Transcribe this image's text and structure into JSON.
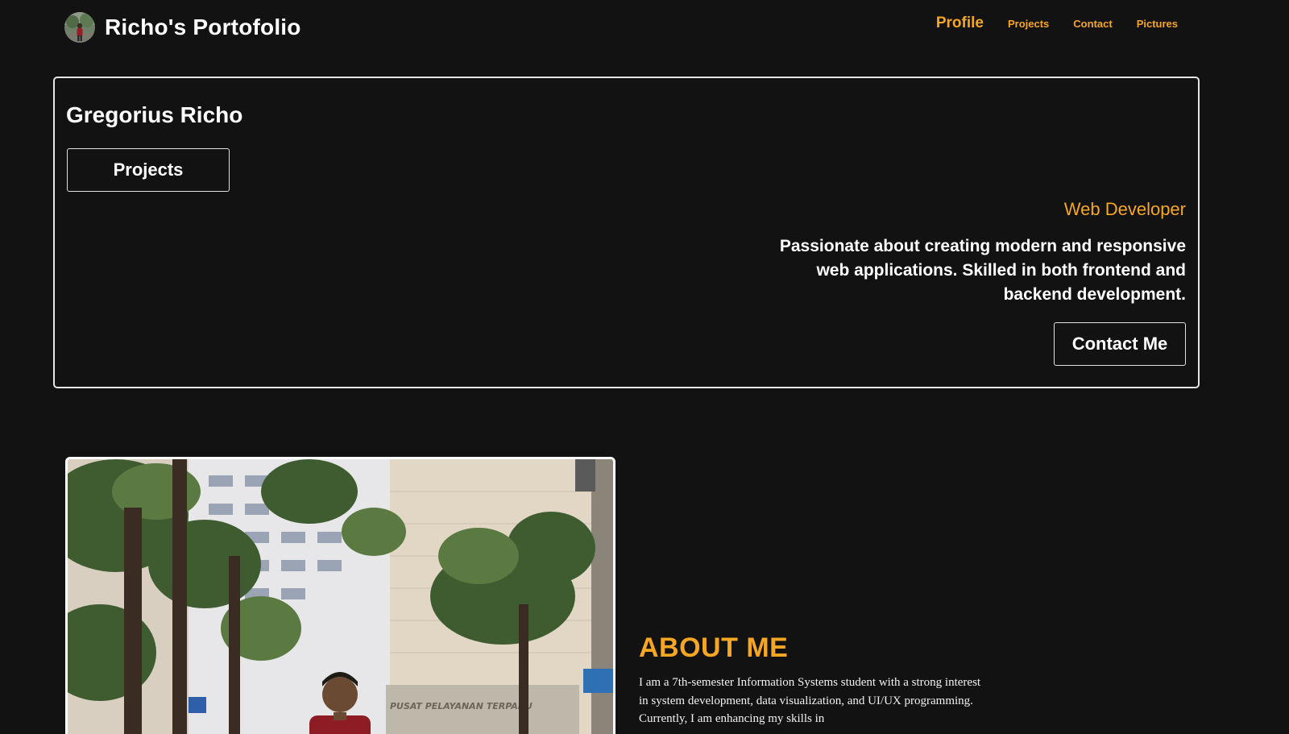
{
  "navbar": {
    "brand_title": "Richo's Portofolio",
    "avatar_icon": "profile-avatar-icon",
    "links": [
      {
        "label": "Profile",
        "active": true
      },
      {
        "label": "Projects",
        "active": false
      },
      {
        "label": "Contact",
        "active": false
      },
      {
        "label": "Pictures",
        "active": false
      }
    ]
  },
  "hero": {
    "name": "Gregorius Richo",
    "projects_button": "Projects",
    "role": "Web Developer",
    "description": "Passionate about creating modern and responsive web applications. Skilled in both frontend and backend development.",
    "contact_button": "Contact Me"
  },
  "about": {
    "title": "ABOUT ME",
    "text": "I am a 7th-semester Information Systems student with a strong interest in system development, data visualization, and UI/UX programming. Currently, I am enhancing my skills in",
    "photo_sign_text": "PUSAT PELAYANAN TERPADU"
  },
  "colors": {
    "background": "#121212",
    "accent": "#f5a623",
    "text": "#ffffff",
    "border": "#e6e6e6"
  }
}
